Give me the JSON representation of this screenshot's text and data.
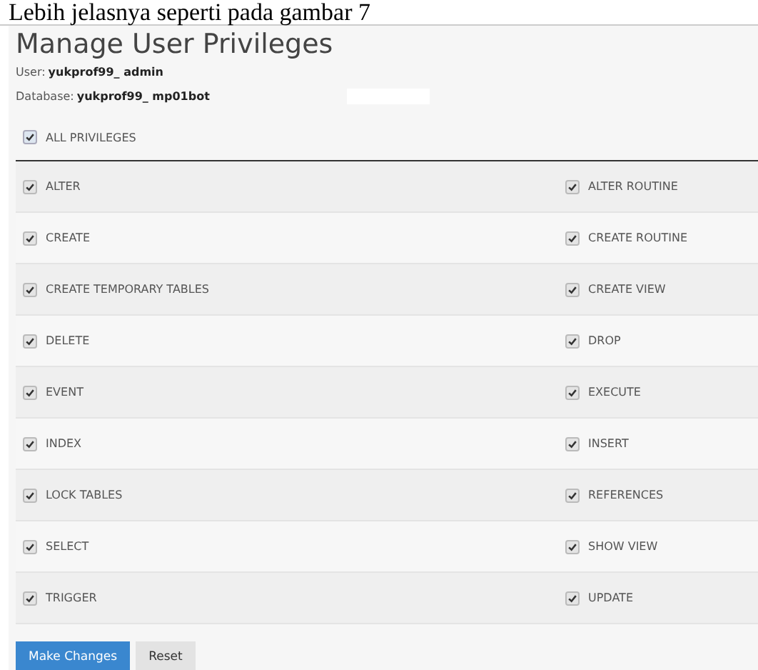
{
  "caption": "Lebih jelasnya seperti pada gambar 7",
  "title": "Manage User Privileges",
  "user": {
    "label": "User:",
    "value": "yukprof99_ admin"
  },
  "database": {
    "label": "Database:",
    "value": "yukprof99_ mp01bot"
  },
  "all_privileges": {
    "label": "ALL PRIVILEGES",
    "checked": true
  },
  "rows": [
    [
      {
        "label": "ALTER",
        "checked": true
      },
      {
        "label": "ALTER ROUTINE",
        "checked": true
      }
    ],
    [
      {
        "label": "CREATE",
        "checked": true
      },
      {
        "label": "CREATE ROUTINE",
        "checked": true
      }
    ],
    [
      {
        "label": "CREATE TEMPORARY TABLES",
        "checked": true
      },
      {
        "label": "CREATE VIEW",
        "checked": true
      }
    ],
    [
      {
        "label": "DELETE",
        "checked": true
      },
      {
        "label": "DROP",
        "checked": true
      }
    ],
    [
      {
        "label": "EVENT",
        "checked": true
      },
      {
        "label": "EXECUTE",
        "checked": true
      }
    ],
    [
      {
        "label": "INDEX",
        "checked": true
      },
      {
        "label": "INSERT",
        "checked": true
      }
    ],
    [
      {
        "label": "LOCK TABLES",
        "checked": true
      },
      {
        "label": "REFERENCES",
        "checked": true
      }
    ],
    [
      {
        "label": "SELECT",
        "checked": true
      },
      {
        "label": "SHOW VIEW",
        "checked": true
      }
    ],
    [
      {
        "label": "TRIGGER",
        "checked": true
      },
      {
        "label": "UPDATE",
        "checked": true
      }
    ]
  ],
  "buttons": [
    {
      "label": "Make Changes",
      "kind": "primary"
    },
    {
      "label": "Reset",
      "kind": "secondary"
    }
  ]
}
